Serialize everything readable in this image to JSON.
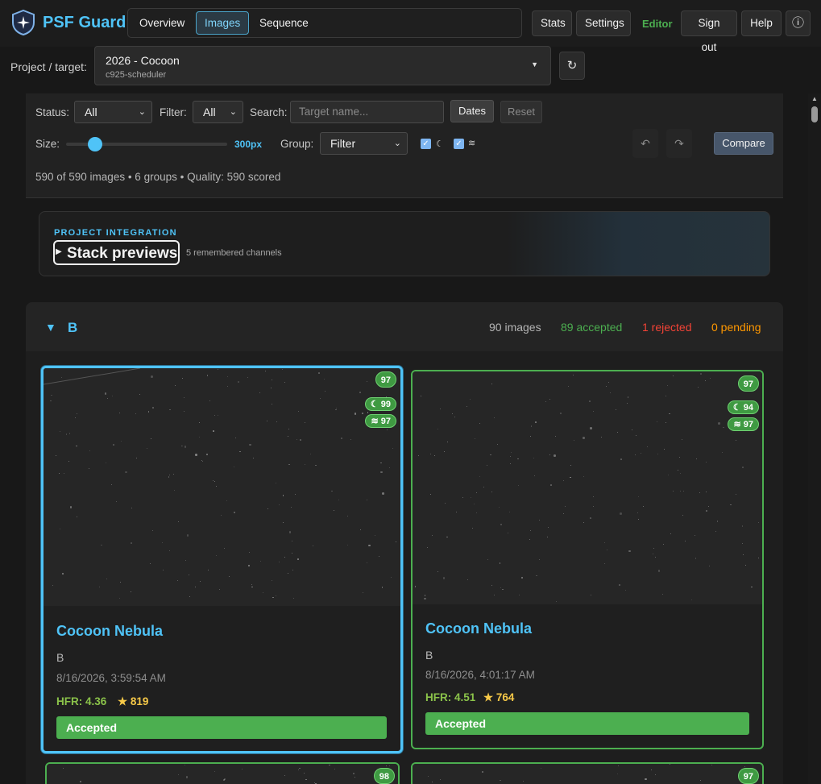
{
  "app": {
    "name": "PSF Guard",
    "tabs": [
      "Overview",
      "Images",
      "Sequence"
    ],
    "active_tab": "Images",
    "header_buttons": {
      "stats": "Stats",
      "settings": "Settings",
      "editor": "Editor",
      "sign_out": "Sign out",
      "help": "Help",
      "info_icon": "ⓘ"
    }
  },
  "project": {
    "label": "Project / target:",
    "selected_title": "2026 - Cocoon",
    "selected_subtitle": "c925-scheduler",
    "refresh_icon": "↻"
  },
  "filters": {
    "status_label": "Status:",
    "status_value": "All",
    "filter_label": "Filter:",
    "filter_value": "All",
    "search_label": "Search:",
    "search_placeholder": "Target name...",
    "dates_button": "Dates",
    "reset_button": "Reset",
    "size_label": "Size:",
    "size_value": "300px",
    "size_fraction": 0.18,
    "group_label": "Group:",
    "group_value": "Filter",
    "show_moon_score": true,
    "show_stack_score": true,
    "undo_icon": "↶",
    "redo_icon": "↷",
    "compare_button": "Compare",
    "summary": "590 of 590 images • 6 groups • Quality: 590 scored"
  },
  "integration": {
    "tag": "PROJECT INTEGRATION",
    "title": "Stack previews",
    "subtitle": "5 remembered channels"
  },
  "group": {
    "toggle_icon": "▼",
    "name": "B",
    "images": "90 images",
    "accepted": "89 accepted",
    "rejected": "1 rejected",
    "pending": "0 pending",
    "colors": {
      "accepted": "#4caf50",
      "rejected": "#f44336",
      "pending": "#ff9800"
    }
  },
  "cards": [
    {
      "title": "Cocoon Nebula",
      "filter": "B",
      "date": "8/16/2026, 3:59:54 AM",
      "hfr": "HFR: 4.36",
      "stars": "★ 819",
      "status": "Accepted",
      "score": "97",
      "moon_score": "99",
      "stack_score": "97",
      "selected": true
    },
    {
      "title": "Cocoon Nebula",
      "filter": "B",
      "date": "8/16/2026, 4:01:17 AM",
      "hfr": "HFR: 4.51",
      "stars": "★ 764",
      "status": "Accepted",
      "score": "97",
      "moon_score": "94",
      "stack_score": "97",
      "selected": false
    },
    {
      "score": "98"
    },
    {
      "score": "97"
    }
  ]
}
